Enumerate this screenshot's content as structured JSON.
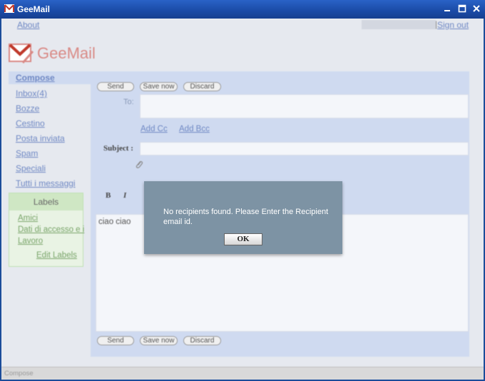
{
  "window": {
    "title": "GeeMail"
  },
  "top": {
    "about": "About",
    "separator": "|",
    "signout": "Sign out"
  },
  "logo": {
    "text": "GeeMail"
  },
  "nav": {
    "compose": "Compose",
    "items": [
      "Inbox(4)",
      "Bozze",
      "Cestino",
      "Posta inviata",
      "Spam",
      "Speciali",
      "Tutti i messaggi"
    ]
  },
  "labels": {
    "heading": "Labels",
    "items": [
      "Amici",
      "Dati di accesso e i",
      "Lavoro"
    ],
    "edit": "Edit Labels"
  },
  "compose": {
    "send": "Send",
    "save_now": "Save now",
    "discard": "Discard",
    "to_label": "To:",
    "add_cc": "Add Cc",
    "add_bcc": "Add Bcc",
    "subject_label": "Subject :",
    "format_bold": "B",
    "format_italic": "I",
    "body": "ciao ciao"
  },
  "status": {
    "text": "Compose"
  },
  "dialog": {
    "message": "No recipients found. Please Enter the Recipient email id.",
    "ok": "OK"
  }
}
